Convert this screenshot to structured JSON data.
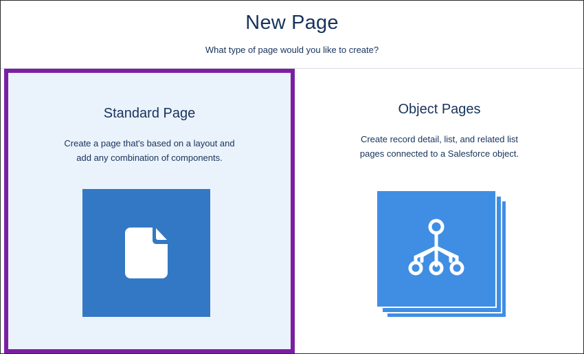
{
  "dialog": {
    "title": "New Page",
    "subtitle": "What type of page would you like to create?"
  },
  "options": [
    {
      "title": "Standard Page",
      "description_lines": [
        "Create a page that's based on a layout and",
        "add any combination of components."
      ],
      "icon": "document-icon",
      "selected": true
    },
    {
      "title": "Object Pages",
      "description_lines": [
        "Create record detail, list, and related list",
        "pages connected to a Salesforce object."
      ],
      "icon": "hierarchy-icon",
      "selected": false
    }
  ],
  "colors": {
    "selection_border": "#7b1fa2",
    "selected_background": "#eaf2fb",
    "standard_tile": "#3378c5",
    "object_tile": "#3f8ee4",
    "text": "#16325c"
  }
}
